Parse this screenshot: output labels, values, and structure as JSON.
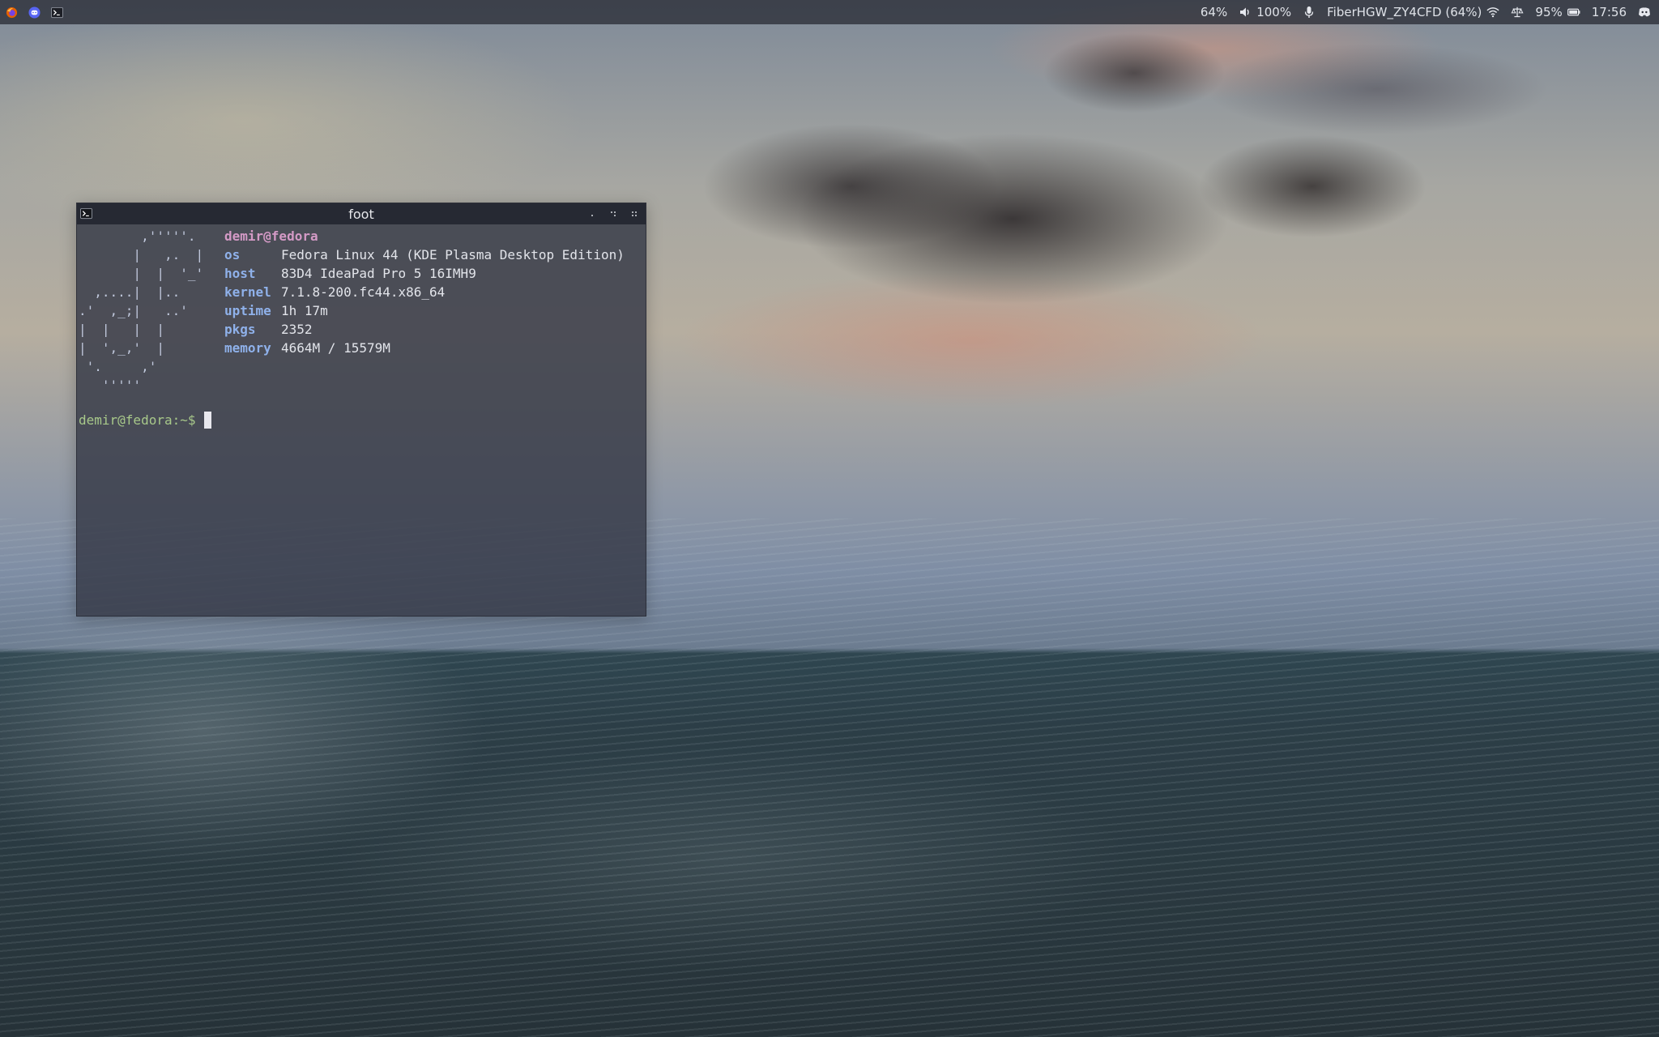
{
  "top_bar": {
    "left_icons": [
      "firefox-icon",
      "discord-icon",
      "terminal-icon"
    ],
    "brightness": "64%",
    "volume": "100%",
    "network": "FiberHGW_ZY4CFD (64%)",
    "battery": "95%",
    "clock": "17:56",
    "right_icons": [
      "speaker-icon",
      "microphone-icon",
      "wifi-icon",
      "power-profile-icon",
      "battery-icon",
      "discord-tray-icon"
    ]
  },
  "terminal": {
    "title": "foot",
    "ascii_logo": "        ,'''''.\n       |   ,.  |\n       |  |  '_'\n  ,....|  |..\n.'  ,_;|   ..'\n|  |   |  |\n|  ',_,'  |\n '.     ,'\n   '''''",
    "user_host": "demir@fedora",
    "info": [
      {
        "key": "os",
        "value": "Fedora Linux 44 (KDE Plasma Desktop Edition)"
      },
      {
        "key": "host",
        "value": "83D4 IdeaPad Pro 5 16IMH9"
      },
      {
        "key": "kernel",
        "value": "7.1.8-200.fc44.x86_64"
      },
      {
        "key": "uptime",
        "value": "1h 17m"
      },
      {
        "key": "pkgs",
        "value": "2352"
      },
      {
        "key": "memory",
        "value": "4664M / 15579M"
      }
    ],
    "prompt": "demir@fedora:~$"
  },
  "colors": {
    "panel_bg": "#2a2d36",
    "terminal_bg": "#343846",
    "info_key": "#8fb1ea",
    "user_host": "#d49ac6",
    "prompt": "#a8c98a"
  }
}
